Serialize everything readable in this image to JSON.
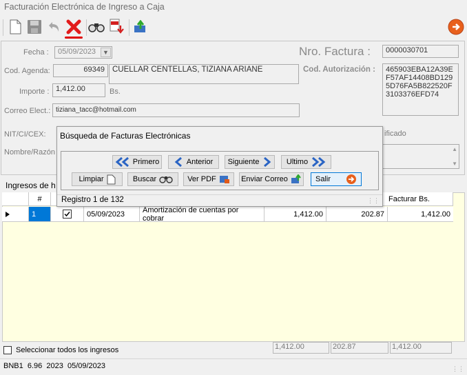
{
  "window": {
    "title": "Facturación Electrónica de Ingreso a Caja"
  },
  "toolbar": {
    "new_icon": "new-document-icon",
    "save_icon": "save-icon",
    "undo_icon": "undo-icon",
    "delete_icon": "delete-x-icon",
    "search_icon": "binoculars-icon",
    "pdf_icon": "pdf-download-icon",
    "export_icon": "export-icon",
    "exit_icon": "exit-arrow-icon",
    "accent": "#e8601c"
  },
  "form": {
    "fecha_label": "Fecha :",
    "fecha_value": "05/09/2023",
    "nro_factura_label": "Nro. Factura :",
    "nro_factura_value": "0000030701",
    "cod_agenda_label": "Cod. Agenda:",
    "cod_agenda_value": "69349",
    "cliente_nombre": "CUELLAR CENTELLAS, TIZIANA ARIANE",
    "cod_autorizacion_label": "Cod. Autorización :",
    "cod_autorizacion_lines": [
      "465903EBA12A39E",
      "F57AF14408BD129",
      "5D76FA5B822520F",
      "3103376EFD74"
    ],
    "importe_label": "Importe :",
    "importe_value": "1,412.00",
    "importe_currency": "Bs.",
    "correo_label": "Correo Elect.:",
    "correo_value": "tiziana_tacc@hotmail.com",
    "nit_label": "NIT/CI/CEX:",
    "nombre_label": "Nombre/Razón",
    "ificado_text": "ificado"
  },
  "dialog": {
    "title": "Búsqueda de Facturas Electrónicas",
    "primero": "Primero",
    "anterior": "Anterior",
    "siguiente": "Siguiente",
    "ultimo": "Ultimo",
    "limpiar": "Limpiar",
    "buscar": "Buscar",
    "ver_pdf": "Ver PDF",
    "enviar_correo": "Enviar Correo",
    "salir": "Salir",
    "status": "Registro 1 de 132"
  },
  "ingresos": {
    "section_label": "Ingresos de h",
    "headers": {
      "num": "#",
      "facturar": "Facturar Bs."
    },
    "rows": [
      {
        "num": "1",
        "checked": true,
        "fecha": "05/09/2023",
        "descripcion": "Amortización de cuentas por cobrar",
        "importe": "1,412.00",
        "col2": "202.87",
        "facturar": "1,412.00"
      }
    ],
    "select_all_label": "Seleccionar todos los ingresos",
    "totals": [
      "1,412.00",
      "202.87",
      "1,412.00"
    ]
  },
  "statusbar": {
    "text": "BNB1  6.96  2023  05/09/2023"
  }
}
